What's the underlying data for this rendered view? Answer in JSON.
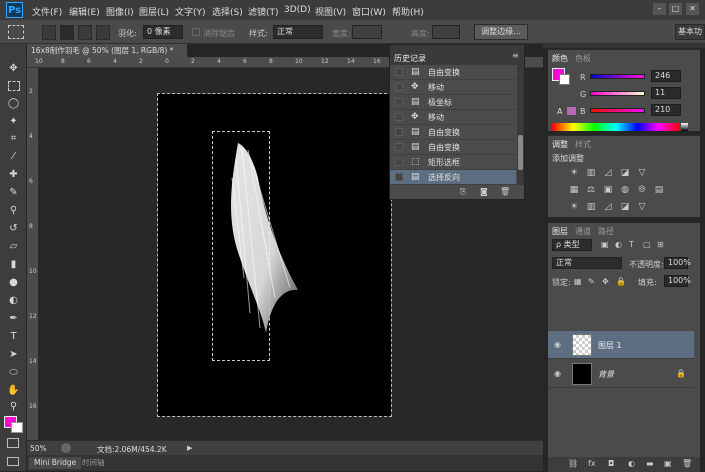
{
  "app": {
    "logo": "Ps"
  },
  "menu": [
    "文件(F)",
    "编辑(E)",
    "图像(I)",
    "图层(L)",
    "文字(Y)",
    "选择(S)",
    "滤镜(T)",
    "3D(D)",
    "视图(V)",
    "窗口(W)",
    "帮助(H)"
  ],
  "window_controls": {
    "minimize": "–",
    "restore": "□",
    "close": "✕"
  },
  "options": {
    "feather_label": "羽化:",
    "feather_value": "0 像素",
    "antialias_label": "消除锯齿",
    "style_label": "样式:",
    "style_value": "正常",
    "width_label": "宽度:",
    "height_label": "高度:",
    "refine_edge": "调整边缘...",
    "workspace": "基本功"
  },
  "document": {
    "tab_title": "16x8制作羽毛 @ 50% (图层 1, RGB/8) *",
    "zoom": "50%",
    "doc_info": "文档:2.06M/454.2K"
  },
  "ruler": {
    "h": [
      "10",
      "8",
      "6",
      "4",
      "2",
      "0",
      "2",
      "4",
      "6",
      "8",
      "10",
      "12",
      "14",
      "16",
      "18",
      "20",
      "22",
      "24",
      "26"
    ],
    "v": [
      "2",
      "4",
      "6",
      "8",
      "10",
      "12",
      "14",
      "16"
    ]
  },
  "bottom_tabs": [
    "Mini Bridge",
    "时间轴"
  ],
  "history": {
    "title": "历史记录",
    "items": [
      {
        "label": "自由变换",
        "icon": "transform-icon"
      },
      {
        "label": "移动",
        "icon": "move-icon"
      },
      {
        "label": "极坐标",
        "icon": "filter-icon"
      },
      {
        "label": "移动",
        "icon": "move-icon"
      },
      {
        "label": "自由变换",
        "icon": "transform-icon"
      },
      {
        "label": "自由变换",
        "icon": "transform-icon"
      },
      {
        "label": "矩形选框",
        "icon": "marquee-icon"
      },
      {
        "label": "选择反向",
        "icon": "invert-icon",
        "selected": true
      }
    ]
  },
  "color": {
    "tabs": [
      "颜色",
      "色板"
    ],
    "channels": [
      {
        "name": "R",
        "value": "246"
      },
      {
        "name": "G",
        "value": "11"
      },
      {
        "name": "B",
        "value": "210"
      }
    ],
    "foreground": "#f60bd2",
    "background": "#ffffff"
  },
  "adjustments": {
    "tabs": [
      "调整",
      "样式"
    ],
    "title": "添加调整"
  },
  "layers": {
    "tabs": [
      "图层",
      "通道",
      "路径"
    ],
    "filter": "ρ 类型",
    "blend_mode": "正常",
    "opacity_label": "不透明度:",
    "opacity": "100%",
    "lock_label": "锁定:",
    "fill_label": "填充:",
    "fill": "100%",
    "items": [
      {
        "name": "图层 1",
        "selected": true
      },
      {
        "name": "背景",
        "locked": true
      }
    ]
  }
}
